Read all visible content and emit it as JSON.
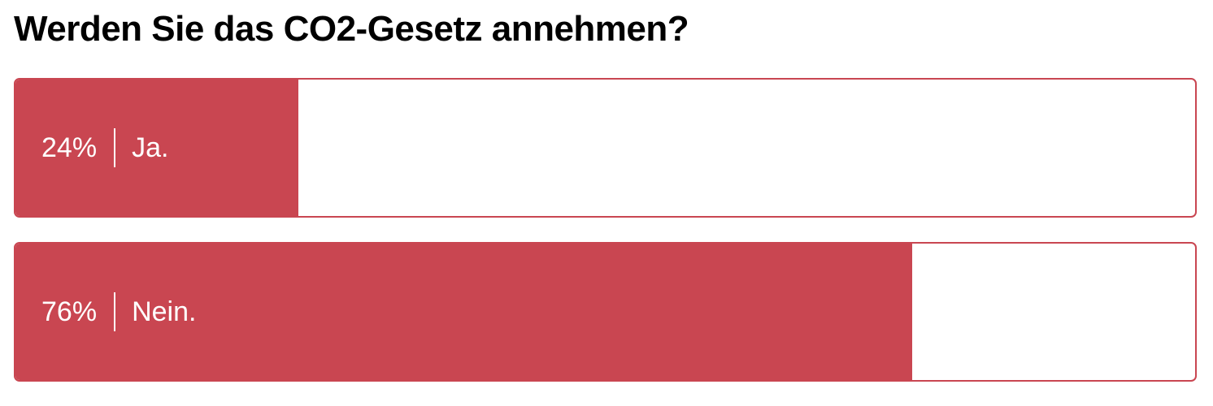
{
  "poll": {
    "question": "Werden Sie das CO2-Gesetz annehmen?",
    "accent_color": "#c94651",
    "options": [
      {
        "percent": "24%",
        "value": 0.24,
        "label": "Ja."
      },
      {
        "percent": "76%",
        "value": 0.76,
        "label": "Nein."
      }
    ]
  }
}
